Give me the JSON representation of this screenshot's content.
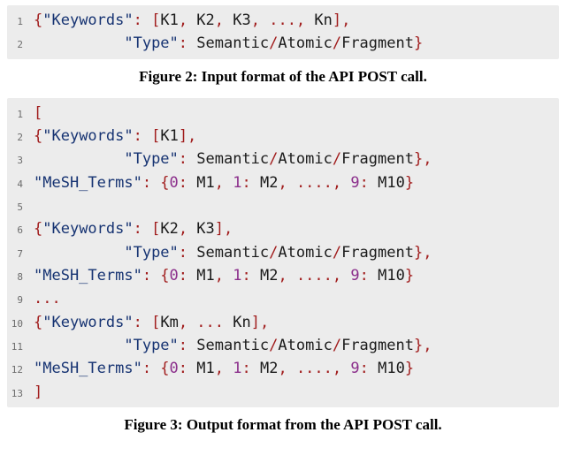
{
  "figure2": {
    "caption": "Figure 2: Input format of the API POST call.",
    "lines": [
      {
        "no": "1",
        "tokens": [
          {
            "cls": "t-punc",
            "t": "{"
          },
          {
            "cls": "t-key",
            "t": "\"Keywords\""
          },
          {
            "cls": "t-punc",
            "t": ": ["
          },
          {
            "cls": "t-plain",
            "t": "K1"
          },
          {
            "cls": "t-punc",
            "t": ", "
          },
          {
            "cls": "t-plain",
            "t": "K2"
          },
          {
            "cls": "t-punc",
            "t": ", "
          },
          {
            "cls": "t-plain",
            "t": "K3"
          },
          {
            "cls": "t-punc",
            "t": ", ..., "
          },
          {
            "cls": "t-plain",
            "t": "Kn"
          },
          {
            "cls": "t-punc",
            "t": "],"
          }
        ]
      },
      {
        "no": "2",
        "tokens": [
          {
            "cls": "t-plain",
            "t": "          "
          },
          {
            "cls": "t-key",
            "t": "\"Type\""
          },
          {
            "cls": "t-punc",
            "t": ": "
          },
          {
            "cls": "t-plain",
            "t": "Semantic"
          },
          {
            "cls": "t-punc",
            "t": "/"
          },
          {
            "cls": "t-plain",
            "t": "Atomic"
          },
          {
            "cls": "t-punc",
            "t": "/"
          },
          {
            "cls": "t-plain",
            "t": "Fragment"
          },
          {
            "cls": "t-punc",
            "t": "}"
          }
        ]
      }
    ]
  },
  "figure3": {
    "caption": "Figure 3: Output format from the API POST call.",
    "lines": [
      {
        "no": "1",
        "tokens": [
          {
            "cls": "t-punc",
            "t": "["
          }
        ]
      },
      {
        "no": "2",
        "tokens": [
          {
            "cls": "t-punc",
            "t": "{"
          },
          {
            "cls": "t-key",
            "t": "\"Keywords\""
          },
          {
            "cls": "t-punc",
            "t": ": ["
          },
          {
            "cls": "t-plain",
            "t": "K1"
          },
          {
            "cls": "t-punc",
            "t": "],"
          }
        ]
      },
      {
        "no": "3",
        "tokens": [
          {
            "cls": "t-plain",
            "t": "          "
          },
          {
            "cls": "t-key",
            "t": "\"Type\""
          },
          {
            "cls": "t-punc",
            "t": ": "
          },
          {
            "cls": "t-plain",
            "t": "Semantic"
          },
          {
            "cls": "t-punc",
            "t": "/"
          },
          {
            "cls": "t-plain",
            "t": "Atomic"
          },
          {
            "cls": "t-punc",
            "t": "/"
          },
          {
            "cls": "t-plain",
            "t": "Fragment"
          },
          {
            "cls": "t-punc",
            "t": "},"
          }
        ]
      },
      {
        "no": "4",
        "tokens": [
          {
            "cls": "t-key",
            "t": "\"MeSH_Terms\""
          },
          {
            "cls": "t-punc",
            "t": ": {"
          },
          {
            "cls": "t-num",
            "t": "0"
          },
          {
            "cls": "t-punc",
            "t": ": "
          },
          {
            "cls": "t-plain",
            "t": "M1"
          },
          {
            "cls": "t-punc",
            "t": ", "
          },
          {
            "cls": "t-num",
            "t": "1"
          },
          {
            "cls": "t-punc",
            "t": ": "
          },
          {
            "cls": "t-plain",
            "t": "M2"
          },
          {
            "cls": "t-punc",
            "t": ", ...., "
          },
          {
            "cls": "t-num",
            "t": "9"
          },
          {
            "cls": "t-punc",
            "t": ": "
          },
          {
            "cls": "t-plain",
            "t": "M10"
          },
          {
            "cls": "t-punc",
            "t": "}"
          }
        ]
      },
      {
        "no": "5",
        "tokens": [
          {
            "cls": "t-plain",
            "t": " "
          }
        ]
      },
      {
        "no": "6",
        "tokens": [
          {
            "cls": "t-punc",
            "t": "{"
          },
          {
            "cls": "t-key",
            "t": "\"Keywords\""
          },
          {
            "cls": "t-punc",
            "t": ": ["
          },
          {
            "cls": "t-plain",
            "t": "K2"
          },
          {
            "cls": "t-punc",
            "t": ", "
          },
          {
            "cls": "t-plain",
            "t": "K3"
          },
          {
            "cls": "t-punc",
            "t": "],"
          }
        ]
      },
      {
        "no": "7",
        "tokens": [
          {
            "cls": "t-plain",
            "t": "          "
          },
          {
            "cls": "t-key",
            "t": "\"Type\""
          },
          {
            "cls": "t-punc",
            "t": ": "
          },
          {
            "cls": "t-plain",
            "t": "Semantic"
          },
          {
            "cls": "t-punc",
            "t": "/"
          },
          {
            "cls": "t-plain",
            "t": "Atomic"
          },
          {
            "cls": "t-punc",
            "t": "/"
          },
          {
            "cls": "t-plain",
            "t": "Fragment"
          },
          {
            "cls": "t-punc",
            "t": "},"
          }
        ]
      },
      {
        "no": "8",
        "tokens": [
          {
            "cls": "t-key",
            "t": "\"MeSH_Terms\""
          },
          {
            "cls": "t-punc",
            "t": ": {"
          },
          {
            "cls": "t-num",
            "t": "0"
          },
          {
            "cls": "t-punc",
            "t": ": "
          },
          {
            "cls": "t-plain",
            "t": "M1"
          },
          {
            "cls": "t-punc",
            "t": ", "
          },
          {
            "cls": "t-num",
            "t": "1"
          },
          {
            "cls": "t-punc",
            "t": ": "
          },
          {
            "cls": "t-plain",
            "t": "M2"
          },
          {
            "cls": "t-punc",
            "t": ", ...., "
          },
          {
            "cls": "t-num",
            "t": "9"
          },
          {
            "cls": "t-punc",
            "t": ": "
          },
          {
            "cls": "t-plain",
            "t": "M10"
          },
          {
            "cls": "t-punc",
            "t": "}"
          }
        ]
      },
      {
        "no": "9",
        "tokens": [
          {
            "cls": "t-punc",
            "t": "..."
          }
        ]
      },
      {
        "no": "10",
        "tokens": [
          {
            "cls": "t-punc",
            "t": "{"
          },
          {
            "cls": "t-key",
            "t": "\"Keywords\""
          },
          {
            "cls": "t-punc",
            "t": ": ["
          },
          {
            "cls": "t-plain",
            "t": "Km"
          },
          {
            "cls": "t-punc",
            "t": ", ... "
          },
          {
            "cls": "t-plain",
            "t": "Kn"
          },
          {
            "cls": "t-punc",
            "t": "],"
          }
        ]
      },
      {
        "no": "11",
        "tokens": [
          {
            "cls": "t-plain",
            "t": "          "
          },
          {
            "cls": "t-key",
            "t": "\"Type\""
          },
          {
            "cls": "t-punc",
            "t": ": "
          },
          {
            "cls": "t-plain",
            "t": "Semantic"
          },
          {
            "cls": "t-punc",
            "t": "/"
          },
          {
            "cls": "t-plain",
            "t": "Atomic"
          },
          {
            "cls": "t-punc",
            "t": "/"
          },
          {
            "cls": "t-plain",
            "t": "Fragment"
          },
          {
            "cls": "t-punc",
            "t": "},"
          }
        ]
      },
      {
        "no": "12",
        "tokens": [
          {
            "cls": "t-key",
            "t": "\"MeSH_Terms\""
          },
          {
            "cls": "t-punc",
            "t": ": {"
          },
          {
            "cls": "t-num",
            "t": "0"
          },
          {
            "cls": "t-punc",
            "t": ": "
          },
          {
            "cls": "t-plain",
            "t": "M1"
          },
          {
            "cls": "t-punc",
            "t": ", "
          },
          {
            "cls": "t-num",
            "t": "1"
          },
          {
            "cls": "t-punc",
            "t": ": "
          },
          {
            "cls": "t-plain",
            "t": "M2"
          },
          {
            "cls": "t-punc",
            "t": ", ...., "
          },
          {
            "cls": "t-num",
            "t": "9"
          },
          {
            "cls": "t-punc",
            "t": ": "
          },
          {
            "cls": "t-plain",
            "t": "M10"
          },
          {
            "cls": "t-punc",
            "t": "}"
          }
        ]
      },
      {
        "no": "13",
        "tokens": [
          {
            "cls": "t-punc",
            "t": "]"
          }
        ]
      }
    ]
  }
}
